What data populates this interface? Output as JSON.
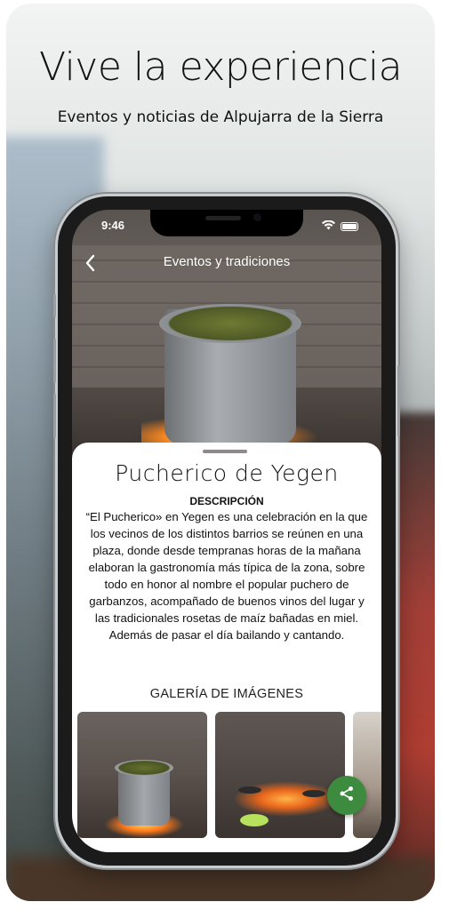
{
  "promo": {
    "headline": "Vive la experiencia",
    "subheadline": "Eventos y noticias de Alpujarra de la Sierra"
  },
  "status_bar": {
    "time": "9:46",
    "icons": [
      "wifi-icon",
      "battery-icon"
    ]
  },
  "app_bar": {
    "title": "Eventos y tradiciones",
    "back_icon": "chevron-left-icon"
  },
  "event": {
    "title": "Pucherico de Yegen",
    "description_label": "DESCRIPCIÓN",
    "description": "“El Pucherico» en Yegen es una celebración en la que los vecinos de los distintos barrios se reúnen en una plaza, donde desde tempranas horas de la mañana elaboran la gastronomía más típica de la zona, sobre todo en honor al nombre el popular puchero de garbanzos, acompañado de buenos vinos del lugar y las tradicionales rosetas de maíz bañadas en miel. Además de pasar el día bailando y cantando.",
    "gallery_label": "GALERÍA DE IMÁGENES",
    "gallery": [
      {
        "name": "gallery-image-1"
      },
      {
        "name": "gallery-image-2"
      },
      {
        "name": "gallery-image-3"
      }
    ]
  },
  "share_button": {
    "icon": "share-icon",
    "color": "#3d8b3f"
  }
}
